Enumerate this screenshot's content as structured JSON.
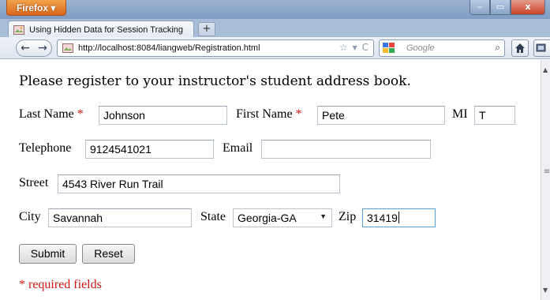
{
  "window": {
    "app_button": "Firefox ▾",
    "minimize_icon": "minimize-icon",
    "maximize_icon": "maximize-icon",
    "close_icon": "close-icon"
  },
  "tab": {
    "title": "Using Hidden Data for Session Tracking",
    "new_tab": "+"
  },
  "nav": {
    "url": "http://localhost:8084/liangweb/Registration.html",
    "search_placeholder": "Google",
    "back_symbol": "←",
    "forward_symbol": "→",
    "bookmark_star": "☆",
    "dropdown_arrow": "▾",
    "reload_symbol": "C",
    "search_glass": "⌕"
  },
  "form": {
    "intro": "Please register to your instructor's student address book.",
    "last_name_label": "Last Name",
    "last_name_value": "Johnson",
    "first_name_label": "First Name",
    "first_name_value": "Pete",
    "mi_label": "MI",
    "mi_value": "T",
    "telephone_label": "Telephone",
    "telephone_value": "9124541021",
    "email_label": "Email",
    "email_value": "",
    "street_label": "Street",
    "street_value": "4543 River Run Trail",
    "city_label": "City",
    "city_value": "Savannah",
    "state_label": "State",
    "state_value": "Georgia-GA",
    "zip_label": "Zip",
    "zip_value": "31419",
    "required_marker": "*",
    "submit_label": "Submit",
    "reset_label": "Reset",
    "required_note": "* required fields"
  },
  "colors": {
    "required": "#d21414",
    "focus_border": "#5b9bd6",
    "firefox_button": "#e07d2c"
  }
}
